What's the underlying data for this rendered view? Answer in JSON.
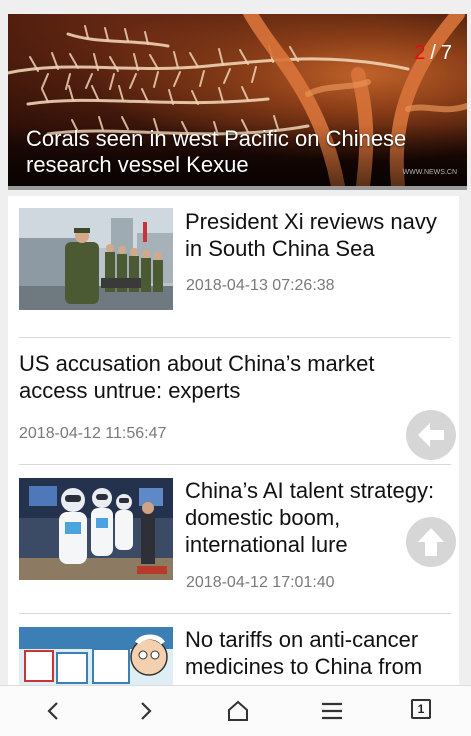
{
  "hero": {
    "caption": "Corals seen in west Pacific on Chinese research vessel Kexue",
    "current": "2",
    "total": "7",
    "separator": "/",
    "watermark": "WWW.NEWS.CN"
  },
  "news": [
    {
      "title": "President Xi reviews navy in South China Sea",
      "time": "2018-04-13 07:26:38",
      "has_image": true,
      "image": "navy-review-photo"
    },
    {
      "title": "US accusation about China’s market access untrue: experts",
      "time": "2018-04-12 11:56:47",
      "has_image": false
    },
    {
      "title": "China’s AI talent strategy: domestic boom, international lure",
      "time": "2018-04-12 17:01:40",
      "has_image": true,
      "image": "robots-photo"
    },
    {
      "title": "No tariffs on anti-cancer medicines to China from",
      "time": "",
      "has_image": true,
      "image": "medicine-cartoon"
    }
  ],
  "floating": {
    "back_icon": "arrow-left-icon",
    "top_icon": "arrow-up-icon"
  },
  "navbar": {
    "back_icon": "chevron-left-icon",
    "forward_icon": "chevron-right-icon",
    "home_icon": "home-icon",
    "menu_icon": "menu-icon",
    "tabs_count": "1"
  },
  "colors": {
    "counter_active": "#e10f0f",
    "divider": "#d9d9d9",
    "time_text": "#7a7a7a"
  }
}
